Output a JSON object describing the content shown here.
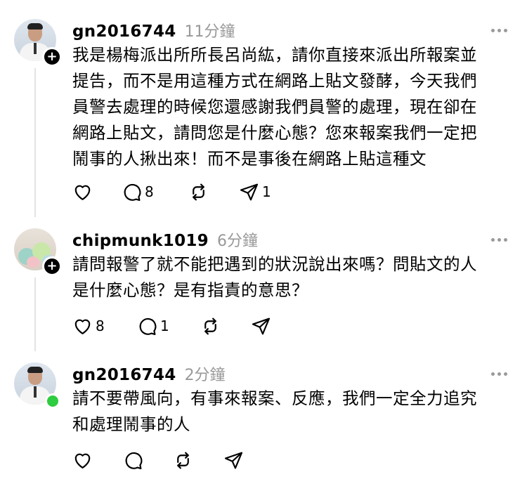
{
  "posts": [
    {
      "username": "gn2016744",
      "time": "11分鐘",
      "content": "我是楊梅派出所所長呂尚紘，請你直接來派出所報案並\n提告，而不是用這種方式在網路上貼文發酵，今天我們\n員警去處理的時候您還感謝我們員警的處理，現在卻在\n網路上貼文，請問您是什麼心態？您來報案我們一定把\n鬧事的人揪出來！而不是事後在網路上貼這種文",
      "likes": "",
      "comments": "8",
      "reposts": "",
      "shares": "1"
    },
    {
      "username": "chipmunk1019",
      "time": "6分鐘",
      "content": "請問報警了就不能把遇到的狀況說出來嗎？問貼文的人\n是什麼心態？是有指責的意思？",
      "likes": "8",
      "comments": "1",
      "reposts": "",
      "shares": ""
    },
    {
      "username": "gn2016744",
      "time": "2分鐘",
      "content": "請不要帶風向，有事來報案、反應，我們一定全力追究\n和處理鬧事的人",
      "likes": "",
      "comments": "",
      "reposts": "",
      "shares": ""
    }
  ],
  "badges": {
    "plus": "+"
  },
  "colors": {
    "online": "#2ecc40",
    "muted": "#999999"
  }
}
